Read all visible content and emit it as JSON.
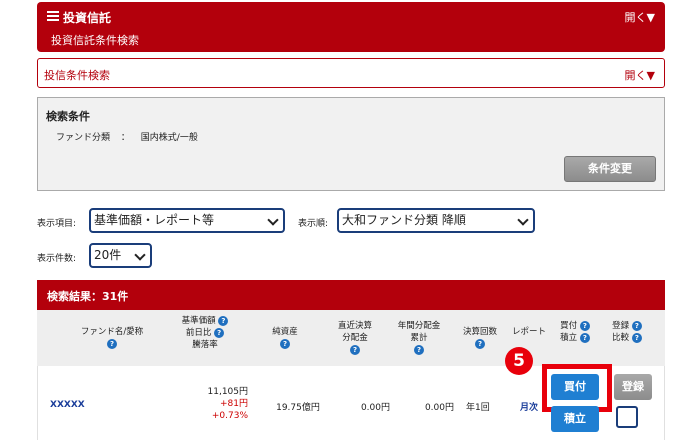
{
  "header": {
    "title": "投資信託",
    "subtitle": "投資信託条件検索",
    "open_label": "開く▼"
  },
  "accordion": {
    "label": "投信条件検索",
    "open_label": "開く▼"
  },
  "conditions": {
    "title": "検索条件",
    "fund_class_label": "ファンド分類",
    "separator": "：",
    "fund_class_value": "国内株式/一般",
    "change_button": "条件変更"
  },
  "filters": {
    "display_item_label": "表示項目:",
    "display_item_value": "基準価額・レポート等",
    "display_order_label": "表示順:",
    "display_order_value": "大和ファンド分類 降順",
    "display_count_label": "表示件数:",
    "display_count_value": "20件"
  },
  "results": {
    "title": "検索結果：31件",
    "columns": {
      "fund_name": "ファンド名/愛称",
      "nav_1": "基準価額",
      "nav_2": "前日比",
      "nav_3": "騰落率",
      "net_assets": "純資産",
      "dist_1": "直近決算",
      "dist_2": "分配金",
      "cum_1": "年間分配金",
      "cum_2": "累計",
      "settle": "決算回数",
      "report": "レポート",
      "buy_1": "買付",
      "buy_2": "積立",
      "reg_1": "登録",
      "reg_2": "比較",
      "help": "?"
    },
    "row": {
      "fund_name": "XXXXX",
      "nav": "11,105円",
      "change": "+81円",
      "change_pct": "+0.73%",
      "net_assets": "19.75億円",
      "last_dist": "0.00円",
      "annual_dist": "0.00円",
      "settle_count": "年1回",
      "report": "月次",
      "buy_button": "買付",
      "accumulate_button": "積立",
      "register_button": "登録"
    }
  },
  "annotation": {
    "step": "5"
  },
  "colors": {
    "brand_red": "#b3000c",
    "button_blue": "#1f7fd2",
    "highlight": "#e8000b"
  }
}
